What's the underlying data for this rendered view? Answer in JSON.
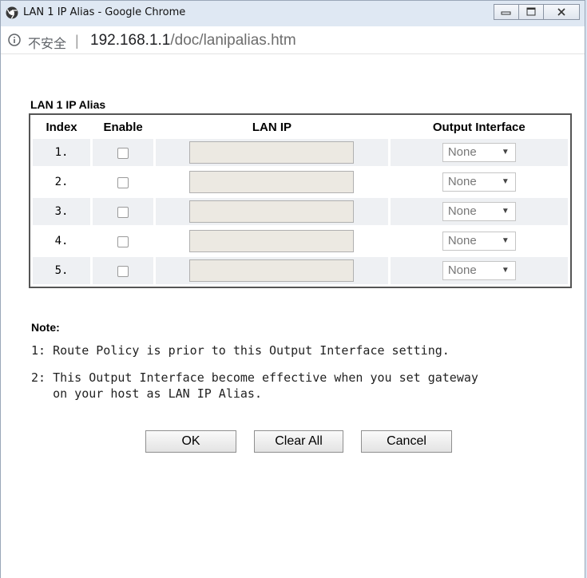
{
  "window": {
    "title": "LAN 1 IP Alias - Google Chrome",
    "controls": [
      "minimize",
      "maximize",
      "close"
    ]
  },
  "address_bar": {
    "security_label": "不安全",
    "separator": "|",
    "host": "192.168.1.1",
    "path": "/doc/lanipalias.htm"
  },
  "page": {
    "section_title": "LAN 1 IP Alias",
    "table": {
      "headers": {
        "index": "Index",
        "enable": "Enable",
        "lan_ip": "LAN IP",
        "output_interface": "Output Interface"
      },
      "rows": [
        {
          "index": "1.",
          "enabled": false,
          "lan_ip": "",
          "output_interface": "None"
        },
        {
          "index": "2.",
          "enabled": false,
          "lan_ip": "",
          "output_interface": "None"
        },
        {
          "index": "3.",
          "enabled": false,
          "lan_ip": "",
          "output_interface": "None"
        },
        {
          "index": "4.",
          "enabled": false,
          "lan_ip": "",
          "output_interface": "None"
        },
        {
          "index": "5.",
          "enabled": false,
          "lan_ip": "",
          "output_interface": "None"
        }
      ]
    },
    "note_title": "Note:",
    "notes": [
      "1: Route Policy is prior to this Output Interface setting.",
      "2: This Output Interface become effective when you set gateway",
      "   on your host as LAN IP Alias."
    ],
    "buttons": {
      "ok": "OK",
      "clear_all": "Clear All",
      "cancel": "Cancel"
    }
  },
  "colors": {
    "titlebar": "#dfe8f3",
    "row_shade": "#eef0f3",
    "input_bg": "#ece9e2"
  }
}
